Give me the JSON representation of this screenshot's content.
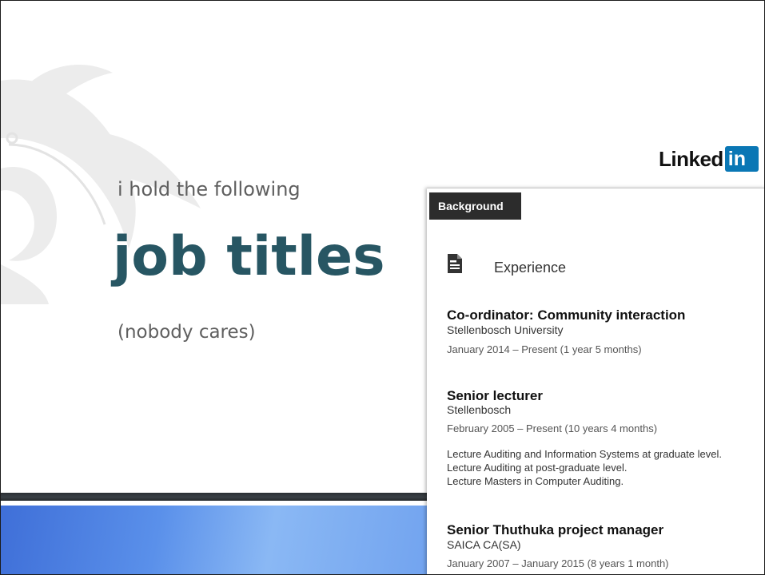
{
  "slide": {
    "subtitle": "i hold the following",
    "title": "job titles",
    "note": "(nobody cares)"
  },
  "logo": {
    "text": "Linked",
    "box": "in"
  },
  "profile": {
    "tab_label": "Background",
    "section_label": "Experience",
    "section_icon": "document-icon",
    "jobs": [
      {
        "title": "Co-ordinator: Community interaction",
        "company": "Stellenbosch University",
        "dates": "January 2014 – Present (1 year 5 months)"
      },
      {
        "title": "Senior lecturer",
        "company": "Stellenbosch",
        "dates": "February 2005 – Present (10 years 4 months)",
        "description": [
          "Lecture Auditing and Information Systems at graduate level.",
          "Lecture Auditing at post-graduate level.",
          "Lecture Masters in Computer Auditing."
        ]
      },
      {
        "title": "Senior Thuthuka project manager",
        "company": "SAICA CA(SA)",
        "dates": "January 2007 – January 2015 (8 years 1 month)"
      }
    ]
  },
  "colors": {
    "title": "#275663",
    "linkedin_blue": "#0a77b5",
    "tab_bg": "#2c2c2c"
  }
}
